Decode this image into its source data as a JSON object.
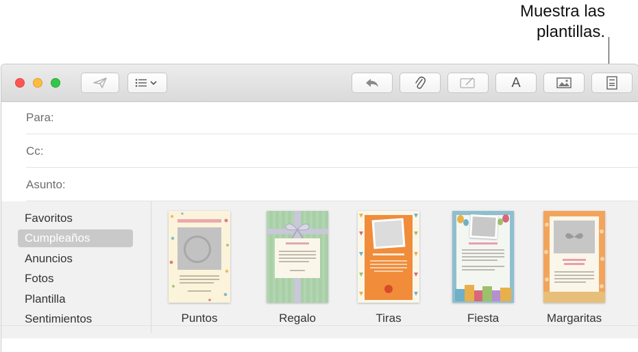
{
  "callout": {
    "line1": "Muestra las",
    "line2": "plantillas."
  },
  "toolbar": {
    "send": "send-icon",
    "format_menu": "list-chevron-icon",
    "reply": "reply-arrow-icon",
    "attach": "paperclip-icon",
    "markup": "markup-icon",
    "font_label": "A",
    "photo": "photo-icon",
    "templates": "templates-icon"
  },
  "fields": {
    "to": "Para:",
    "cc": "Cc:",
    "subject": "Asunto:"
  },
  "categories": [
    "Favoritos",
    "Cumpleaños",
    "Anuncios",
    "Fotos",
    "Plantilla",
    "Sentimientos"
  ],
  "selected_category": "Cumpleaños",
  "templates": [
    {
      "label": "Puntos"
    },
    {
      "label": "Regalo"
    },
    {
      "label": "Tiras"
    },
    {
      "label": "Fiesta"
    },
    {
      "label": "Margaritas"
    }
  ],
  "colors": {
    "close": "#fc5753",
    "minimize": "#fdbc40",
    "zoom": "#33c748",
    "selection": "#c9c9c9",
    "panel": "#f1f1f1"
  }
}
